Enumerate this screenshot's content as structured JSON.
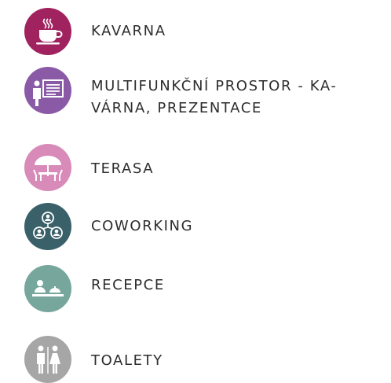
{
  "items": [
    {
      "id": "kavarna",
      "label": "KAVARNA",
      "label_line2": "",
      "icon": "coffee-cup-icon",
      "color": "#a0235f"
    },
    {
      "id": "multifunkcni",
      "label": "MULTIFUNKČNÍ PROSTOR - KA-",
      "label_line2": "VÁRNA, PREZENTACE",
      "icon": "presentation-icon",
      "color": "#8a5aa7"
    },
    {
      "id": "terasa",
      "label": "TERASA",
      "label_line2": "",
      "icon": "parasol-table-icon",
      "color": "#d88ab8"
    },
    {
      "id": "coworking",
      "label": "COWORKING",
      "label_line2": "",
      "icon": "network-people-icon",
      "color": "#3a6069"
    },
    {
      "id": "recepce",
      "label": "RECEPCE",
      "label_line2": "",
      "icon": "reception-bell-icon",
      "color": "#76a69c"
    },
    {
      "id": "toalety",
      "label": "TOALETY",
      "label_line2": "",
      "icon": "restroom-icon",
      "color": "#a6a6a6"
    }
  ]
}
